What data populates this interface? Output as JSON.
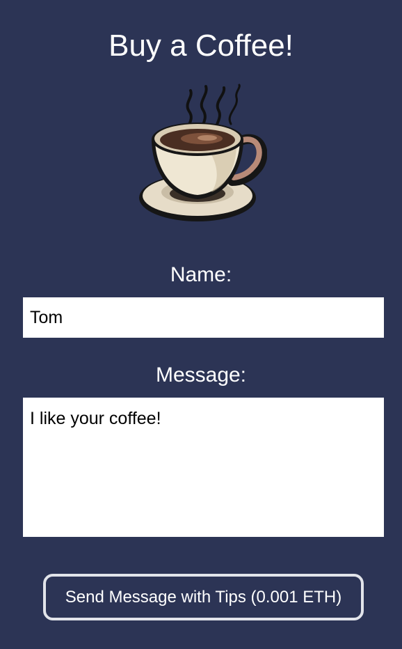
{
  "page": {
    "title": "Buy a Coffee!"
  },
  "illustration": {
    "icon": "coffee-cup-icon"
  },
  "form": {
    "name_label": "Name:",
    "name_value": "Tom",
    "message_label": "Message:",
    "message_value": "I like your coffee!",
    "submit_label": "Send Message with Tips (0.001 ETH)"
  },
  "colors": {
    "background": "#2c3455",
    "text": "#ffffff",
    "input_background": "#ffffff",
    "button_border": "#e2e4ea"
  }
}
